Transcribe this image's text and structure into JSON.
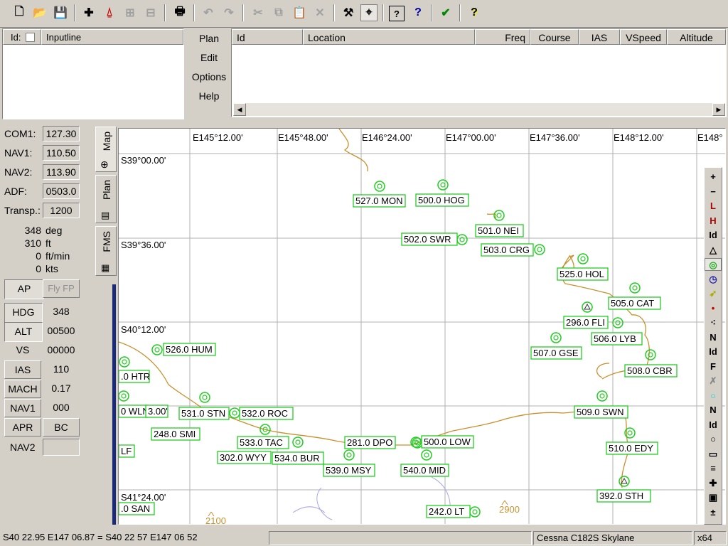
{
  "toolbar": {
    "buttons": [
      {
        "name": "new-icon",
        "glyph": "🗋"
      },
      {
        "name": "open-icon",
        "glyph": "📂"
      },
      {
        "name": "save-icon",
        "glyph": "💾"
      },
      {
        "name": "add-waypoint-icon",
        "glyph": "✚"
      },
      {
        "name": "add-airport-icon",
        "glyph": "⍙"
      },
      {
        "name": "insert-icon",
        "glyph": "⊞"
      },
      {
        "name": "delete-icon",
        "glyph": "⊟"
      },
      {
        "name": "print-icon",
        "glyph": "🖶"
      },
      {
        "name": "undo-icon",
        "glyph": "↶"
      },
      {
        "name": "redo-icon",
        "glyph": "↷"
      },
      {
        "name": "cut-icon",
        "glyph": "✂"
      },
      {
        "name": "copy-icon",
        "glyph": "⧉"
      },
      {
        "name": "paste-icon",
        "glyph": "📋"
      },
      {
        "name": "clear-icon",
        "glyph": "✕"
      },
      {
        "name": "hammer-icon",
        "glyph": "⚒"
      },
      {
        "name": "locate-icon",
        "glyph": "⌖"
      },
      {
        "name": "help-topics-icon",
        "glyph": "?"
      },
      {
        "name": "context-help-icon",
        "glyph": "?"
      },
      {
        "name": "check-icon",
        "glyph": "✔"
      },
      {
        "name": "about-icon",
        "glyph": "?"
      }
    ]
  },
  "input": {
    "id_label": "Id:",
    "inputline_label": "Inputline"
  },
  "menus": {
    "plan": "Plan",
    "edit": "Edit",
    "options": "Options",
    "help": "Help"
  },
  "flightplan": {
    "columns": [
      "Id",
      "Location",
      "Freq",
      "Course",
      "IAS",
      "VSpeed",
      "Altitude"
    ]
  },
  "radios": {
    "com1_label": "COM1:",
    "com1": "127.30",
    "nav1_label": "NAV1:",
    "nav1": "110.50",
    "nav2_label": "NAV2:",
    "nav2": "113.90",
    "adf_label": "ADF:",
    "adf": "0503.0",
    "transp_label": "Transp.:",
    "transp": "1200"
  },
  "instruments": [
    {
      "value": "348",
      "unit": "deg"
    },
    {
      "value": "310",
      "unit": "ft"
    },
    {
      "value": "0",
      "unit": "ft/min"
    },
    {
      "value": "0",
      "unit": "kts"
    }
  ],
  "autopilot": {
    "ap": "AP",
    "flyfp": "Fly FP",
    "hdg": "HDG",
    "hdg_val": "348",
    "alt": "ALT",
    "alt_val": "00500",
    "vs": "VS",
    "vs_val": "00000",
    "ias": "IAS",
    "ias_val": "110",
    "mach": "MACH",
    "mach_val": "0.17",
    "nav1": "NAV1",
    "nav1_val": "000",
    "apr": "APR",
    "bc": "BC",
    "nav2": "NAV2",
    "nav2_val": ""
  },
  "tabs": {
    "map": "Map",
    "plan": "Plan",
    "fms": "FMS"
  },
  "map": {
    "lon_labels": [
      "E145°12.00'",
      "E145°48.00'",
      "E146°24.00'",
      "E147°00.00'",
      "E147°36.00'",
      "E148°12.00'",
      "E148°"
    ],
    "lat_labels": [
      "S39°00.00'",
      "S39°36.00'",
      "S40°12.00'",
      "S41°24.00'"
    ],
    "stations": [
      {
        "t": "527.0 MON"
      },
      {
        "t": "500.0 HOG"
      },
      {
        "t": "501.0 NEI"
      },
      {
        "t": "502.0 SWR"
      },
      {
        "t": "503.0 CRG"
      },
      {
        "t": "525.0 HOL"
      },
      {
        "t": "505.0 CAT"
      },
      {
        "t": "296.0 FLI"
      },
      {
        "t": "506.0 LYB"
      },
      {
        "t": "507.0 GSE"
      },
      {
        "t": "508.0 CBR"
      },
      {
        "t": "526.0 HUM"
      },
      {
        "t": ".0 HTR"
      },
      {
        "t": "0 WLN"
      },
      {
        "t": "3.00'"
      },
      {
        "t": "531.0 STN"
      },
      {
        "t": "532.0 ROC"
      },
      {
        "t": "248.0 SMI"
      },
      {
        "t": "LF"
      },
      {
        "t": "533.0 TAC"
      },
      {
        "t": "302.0 WYY"
      },
      {
        "t": "534.0 BUR"
      },
      {
        "t": "281.0 DPO"
      },
      {
        "t": "500.0 LOW"
      },
      {
        "t": "539.0 MSY"
      },
      {
        "t": "540.0 MID"
      },
      {
        "t": "509.0 SWN"
      },
      {
        "t": "510.0 EDY"
      },
      {
        "t": "392.0 STH"
      },
      {
        "t": ".0 SAN"
      },
      {
        "t": "242.0 LT"
      }
    ],
    "elevations": [
      "2100",
      "2900"
    ]
  },
  "righttools": [
    "+",
    "−",
    "L",
    "H",
    "Id",
    "△",
    "◎",
    "◷",
    "➶",
    "•",
    "⁖",
    "N",
    "Id",
    "F",
    "✗",
    "○",
    "N",
    "Id",
    "○",
    "▭",
    "≡",
    "✚",
    "▣",
    "±"
  ],
  "status": {
    "coords": "S40 22.95  E147 06.87  =  S40 22 57   E147 06 52",
    "aircraft": "Cessna C182S Skylane",
    "zoom": "x64"
  },
  "colors": {
    "station_box": "#22cc22",
    "coast": "#c8902c",
    "lake": "#a8a8e8",
    "grid": "#b0b0b0",
    "scale_bar": "#1a2a7a"
  }
}
